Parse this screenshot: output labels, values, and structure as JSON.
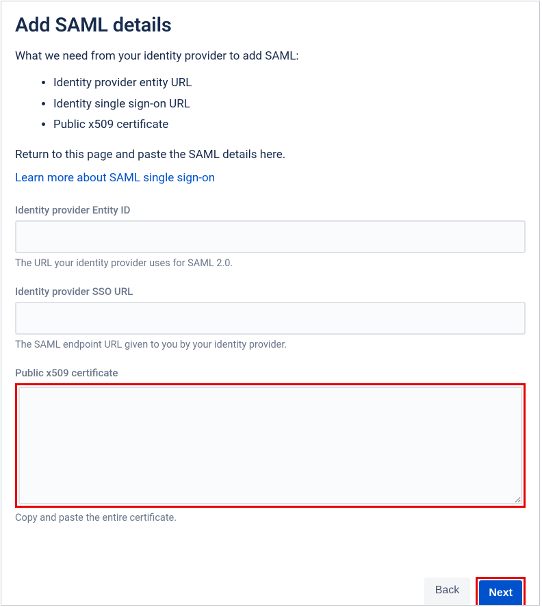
{
  "title": "Add SAML details",
  "intro": "What we need from your identity provider to add SAML:",
  "requirements": [
    "Identity provider entity URL",
    "Identity single sign-on URL",
    "Public x509 certificate"
  ],
  "returnText": "Return to this page and paste the SAML details here.",
  "learnMoreLink": "Learn more about SAML single sign-on",
  "fields": {
    "entityId": {
      "label": "Identity provider Entity ID",
      "value": "",
      "help": "The URL your identity provider uses for SAML 2.0."
    },
    "ssoUrl": {
      "label": "Identity provider SSO URL",
      "value": "",
      "help": "The SAML endpoint URL given to you by your identity provider."
    },
    "certificate": {
      "label": "Public x509 certificate",
      "value": "",
      "help": "Copy and paste the entire certificate."
    }
  },
  "buttons": {
    "back": "Back",
    "next": "Next"
  }
}
